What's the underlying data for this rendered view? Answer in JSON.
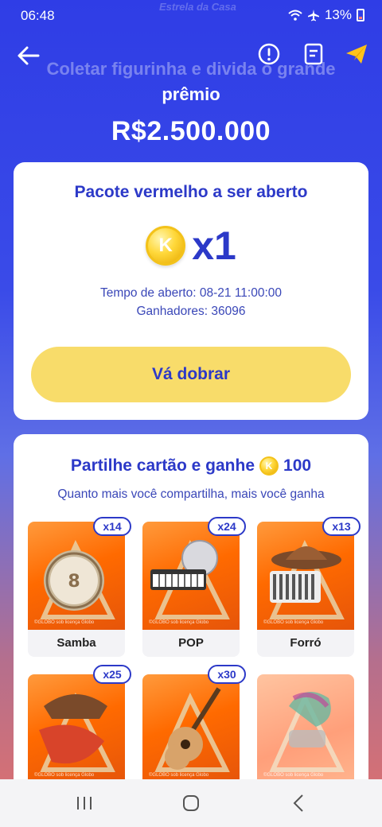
{
  "status": {
    "time": "06:48",
    "battery": "13%"
  },
  "header": {
    "logo_text": "Estrela da Casa",
    "faded_title": "Coletar figurinha e divida o grande",
    "title_line2": "prêmio",
    "prize": "R$2.500.000"
  },
  "packet_card": {
    "title": "Pacote vermelho a ser aberto",
    "coin_symbol": "K",
    "count": "x1",
    "open_time": "Tempo de aberto: 08-21 11:00:00",
    "winners": "Ganhadores: 36096",
    "button_label": "Vá dobrar"
  },
  "share_card": {
    "title_prefix": "Partilhe cartão e ganhe",
    "coin_symbol": "K",
    "reward": "100",
    "subtitle": "Quanto mais você compartilha, mais você ganha",
    "watermark": "©GLOBO sob licença Globo",
    "stickers": [
      {
        "label": "Samba",
        "count": "x14",
        "icon": "pandeiro-icon"
      },
      {
        "label": "POP",
        "count": "x24",
        "icon": "disco-ball-keyboard-icon"
      },
      {
        "label": "Forró",
        "count": "x13",
        "icon": "accordion-hat-icon"
      },
      {
        "label": "",
        "count": "x25",
        "icon": "hat-fan-icon"
      },
      {
        "label": "",
        "count": "x30",
        "icon": "guitar-icon"
      },
      {
        "label": "",
        "count": "",
        "icon": "electric-guitar-icon"
      }
    ]
  },
  "colors": {
    "accent": "#2c39c8",
    "button": "#f8dc6a",
    "coin": "#ffd83a"
  }
}
